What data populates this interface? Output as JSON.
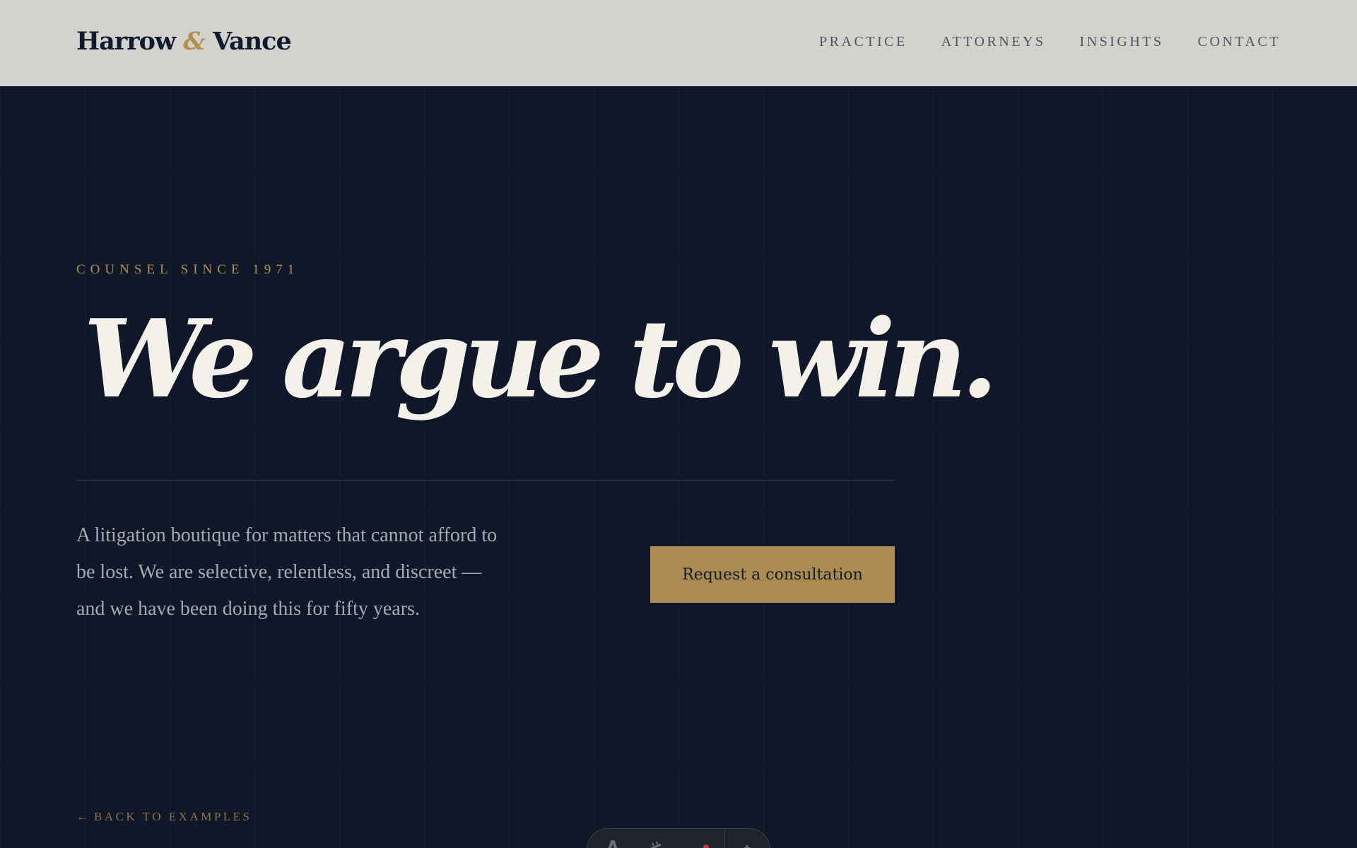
{
  "header": {
    "brand": {
      "first": "Harrow",
      "ampersand": "&",
      "second": "Vance"
    },
    "nav": [
      {
        "label": "PRACTICE"
      },
      {
        "label": "ATTORNEYS"
      },
      {
        "label": "INSIGHTS"
      },
      {
        "label": "CONTACT"
      }
    ]
  },
  "hero": {
    "eyebrow": "COUNSEL SINCE 1971",
    "headline": "We argue to win.",
    "lede": "A litigation boutique for matters that cannot afford to be lost. We are selective, relentless, and discreet — and we have been doing this for fifty years.",
    "cta_label": "Request a consultation"
  },
  "footer": {
    "back_arrow": "←",
    "back_label": "BACK TO EXAMPLES"
  },
  "toolbar": {
    "icons": [
      "font-icon",
      "brush-icon",
      "slider-icon",
      "gear-icon"
    ],
    "notification_dot_color": "#c0354a"
  },
  "colors": {
    "navy": "#0f172a",
    "gold": "#ab8b4f",
    "header_bg": "#d4d2cd",
    "headline": "#f4f1ea"
  }
}
